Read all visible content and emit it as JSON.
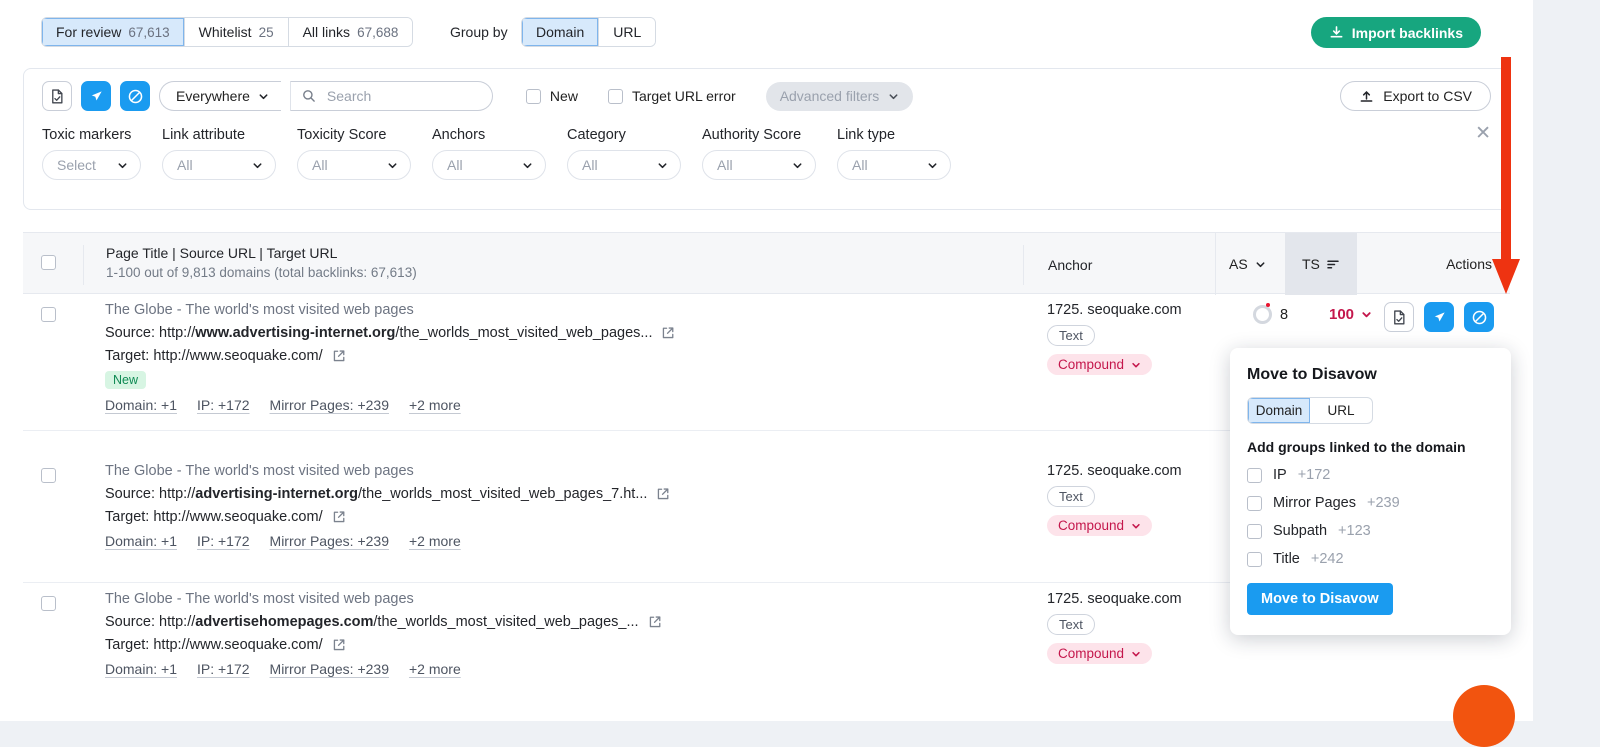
{
  "header": {
    "tabs": [
      {
        "label": "For review",
        "count": "67,613",
        "active": true
      },
      {
        "label": "Whitelist",
        "count": "25",
        "active": false
      },
      {
        "label": "All links",
        "count": "67,688",
        "active": false
      }
    ],
    "group_by_label": "Group by",
    "group_by_options": [
      {
        "label": "Domain",
        "active": true
      },
      {
        "label": "URL",
        "active": false
      }
    ],
    "import_button": "Import backlinks",
    "import_icon": "download-icon"
  },
  "toolbar": {
    "icons": [
      {
        "name": "whitelist-icon",
        "style": "ghost"
      },
      {
        "name": "send-icon",
        "style": "blue"
      },
      {
        "name": "disavow-icon",
        "style": "blue"
      }
    ],
    "scope_select": "Everywhere",
    "search_placeholder": "Search",
    "search_value": "",
    "checkbox_new": "New",
    "checkbox_target_url_error": "Target URL error",
    "advanced_filters": "Advanced filters",
    "export_button": "Export to CSV",
    "export_icon": "upload-icon",
    "close_icon": "close-icon"
  },
  "filters": [
    {
      "label": "Toxic markers",
      "value": "Select",
      "width": "w-sel"
    },
    {
      "label": "Link attribute",
      "value": "All",
      "width": "w-all"
    },
    {
      "label": "Toxicity Score",
      "value": "All",
      "width": "w-all"
    },
    {
      "label": "Anchors",
      "value": "All",
      "width": "w-all"
    },
    {
      "label": "Category",
      "value": "All",
      "width": "w-all"
    },
    {
      "label": "Authority Score",
      "value": "All",
      "width": "w-all"
    },
    {
      "label": "Link type",
      "value": "All",
      "width": "w-all"
    }
  ],
  "table": {
    "header_title": "Page Title | Source URL | Target URL",
    "header_subtitle": "1-100 out of 9,813 domains (total backlinks: 67,613)",
    "col_anchor": "Anchor",
    "col_as": "AS",
    "col_ts": "TS",
    "col_actions": "Actions",
    "rows": [
      {
        "title": "The Globe - The world's most visited web pages",
        "source_label": "Source: ",
        "source_prefix": "http://",
        "source_domain": "www.advertising-internet.org",
        "source_path": "/the_worlds_most_visited_web_pages...",
        "target_label": "Target: ",
        "target_url": "http://www.seoquake.com/",
        "badge": "New",
        "links": [
          "Domain: +1",
          "IP: +172",
          "Mirror Pages: +239",
          "+2 more"
        ],
        "anchor": "1725. seoquake.com",
        "tag_type": "Text",
        "tag_category": "Compound",
        "as": "8",
        "ts": "100"
      },
      {
        "title": "The Globe - The world's most visited web pages",
        "source_label": "Source: ",
        "source_prefix": "http://",
        "source_domain": "advertising-internet.org",
        "source_path": "/the_worlds_most_visited_web_pages_7.ht...",
        "target_label": "Target: ",
        "target_url": "http://www.seoquake.com/",
        "badge": "",
        "links": [
          "Domain: +1",
          "IP: +172",
          "Mirror Pages: +239",
          "+2 more"
        ],
        "anchor": "1725. seoquake.com",
        "tag_type": "Text",
        "tag_category": "Compound",
        "as": "",
        "ts": ""
      },
      {
        "title": "The Globe - The world's most visited web pages",
        "source_label": "Source: ",
        "source_prefix": "http://",
        "source_domain": "advertisehomepages.com",
        "source_path": "/the_worlds_most_visited_web_pages_...",
        "target_label": "Target: ",
        "target_url": "http://www.seoquake.com/",
        "badge": "",
        "links": [
          "Domain: +1",
          "IP: +172",
          "Mirror Pages: +239",
          "+2 more"
        ],
        "anchor": "1725. seoquake.com",
        "tag_type": "Text",
        "tag_category": "Compound",
        "as": "",
        "ts": ""
      }
    ]
  },
  "popup": {
    "title": "Move to Disavow",
    "mode_options": [
      {
        "label": "Domain",
        "active": true
      },
      {
        "label": "URL",
        "active": false
      }
    ],
    "subtitle": "Add groups linked to the domain",
    "options": [
      {
        "label": "IP",
        "count": "+172",
        "checked": false
      },
      {
        "label": "Mirror Pages",
        "count": "+239",
        "checked": false
      },
      {
        "label": "Subpath",
        "count": "+123",
        "checked": false
      },
      {
        "label": "Title",
        "count": "+242",
        "checked": false
      }
    ],
    "button": "Move to Disavow"
  },
  "annotation": {
    "arrow_color": "#ee3311",
    "target": "disavow-action-button"
  },
  "colors": {
    "accent_blue": "#1a9bf0",
    "brand_green": "#17a67f",
    "toxic_red": "#c4174c",
    "badge_green": "#0f8a54",
    "chat_orange": "#f2540f"
  }
}
